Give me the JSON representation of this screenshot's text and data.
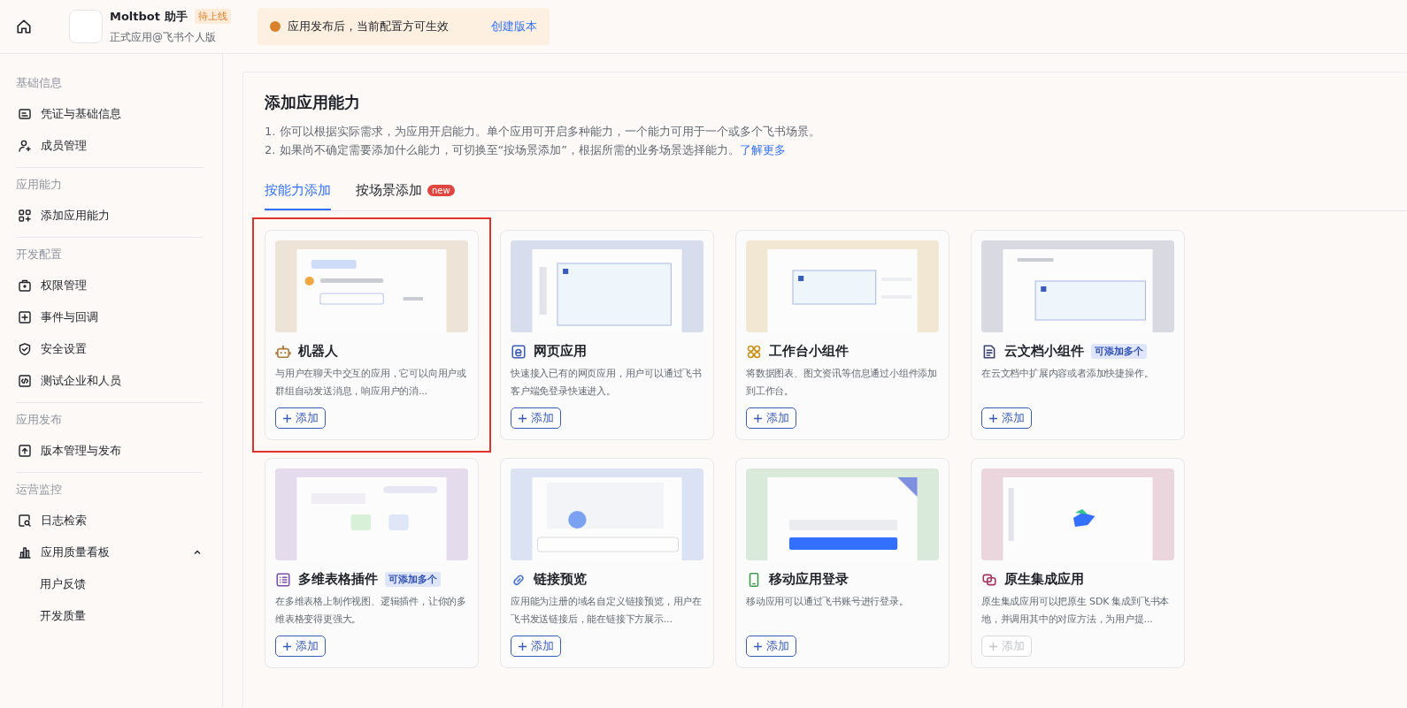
{
  "header": {
    "app_name": "Moltbot 助手",
    "status_badge": "待上线",
    "app_subtitle": "正式应用@飞书个人版",
    "notice": "应用发布后，当前配置方可生效",
    "notice_link": "创建版本"
  },
  "sidebar": {
    "groups": [
      {
        "title": "基础信息",
        "items": [
          {
            "label": "凭证与基础信息"
          },
          {
            "label": "成员管理"
          }
        ]
      },
      {
        "title": "应用能力",
        "items": [
          {
            "label": "添加应用能力"
          }
        ]
      },
      {
        "title": "开发配置",
        "items": [
          {
            "label": "权限管理"
          },
          {
            "label": "事件与回调"
          },
          {
            "label": "安全设置"
          },
          {
            "label": "测试企业和人员"
          }
        ]
      },
      {
        "title": "应用发布",
        "items": [
          {
            "label": "版本管理与发布"
          }
        ]
      },
      {
        "title": "运营监控",
        "items": [
          {
            "label": "日志检索"
          },
          {
            "label": "应用质量看板",
            "expanded": true,
            "children": [
              {
                "label": "用户反馈"
              },
              {
                "label": "开发质量"
              }
            ]
          }
        ]
      }
    ]
  },
  "main": {
    "title": "添加应用能力",
    "notes": [
      "1. 你可以根据实际需求，为应用开启能力。单个应用可开启多种能力，一个能力可用于一个或多个飞书场景。",
      "2. 如果尚不确定需要添加什么能力，可切换至“按场景添加”，根据所需的业务场景选择能力。"
    ],
    "learn_more": "了解更多",
    "tabs": [
      {
        "label": "按能力添加",
        "selected": true
      },
      {
        "label": "按场景添加",
        "badge": "new",
        "selected": false
      }
    ],
    "cards": [
      {
        "title": "机器人",
        "description": "与用户在聊天中交互的应用，它可以向用户或群组自动发送消息，响应用户的消...",
        "button": "添加",
        "disabled": false,
        "highlighted": true,
        "color": "#b07a3a"
      },
      {
        "title": "网页应用",
        "description": "快速接入已有的网页应用，用户可以通过飞书客户端免登录快速进入。",
        "button": "添加",
        "disabled": false,
        "highlighted": false,
        "color": "#3a5bb8"
      },
      {
        "title": "工作台小组件",
        "description": "将数据图表、图文资讯等信息通过小组件添加到工作台。",
        "button": "添加",
        "disabled": false,
        "highlighted": false,
        "color": "#c8901a"
      },
      {
        "title": "云文档小组件",
        "badge": "可添加多个",
        "description": "在云文档中扩展内容或者添加快捷操作。",
        "button": "添加",
        "disabled": false,
        "highlighted": false,
        "color": "#3b4470"
      },
      {
        "title": "多维表格插件",
        "badge": "可添加多个",
        "description": "在多维表格上制作视图、逻辑插件，让你的多维表格变得更强大。",
        "button": "添加",
        "disabled": false,
        "highlighted": false,
        "color": "#7b4fb0"
      },
      {
        "title": "链接预览",
        "description": "应用能为注册的域名自定义链接预览，用户在飞书发送链接后，能在链接下方展示...",
        "button": "添加",
        "disabled": false,
        "highlighted": false,
        "color": "#4a72d8"
      },
      {
        "title": "移动应用登录",
        "description": "移动应用可以通过飞书账号进行登录。",
        "button": "添加",
        "disabled": false,
        "highlighted": false,
        "color": "#3c9a4a"
      },
      {
        "title": "原生集成应用",
        "description": "原生集成应用可以把原生 SDK 集成到飞书本地，并调用其中的对应方法，为用户提...",
        "button": "添加",
        "disabled": true,
        "highlighted": false,
        "color": "#a8325e"
      }
    ]
  }
}
